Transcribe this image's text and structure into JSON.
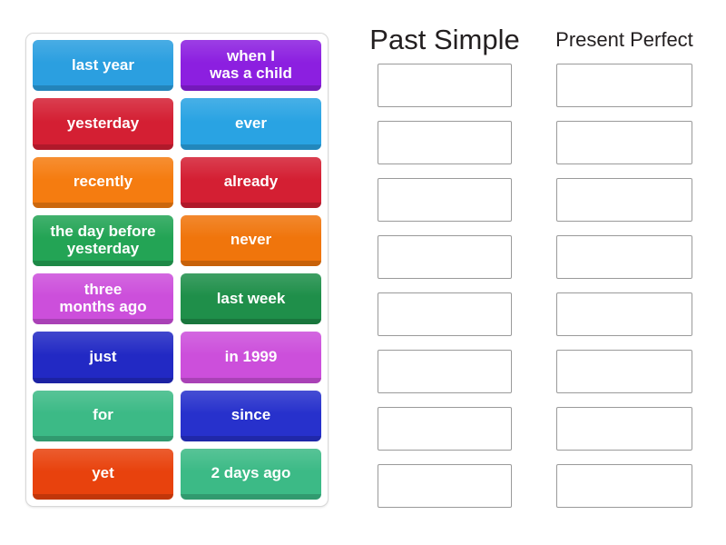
{
  "activity": {
    "type": "group-sort",
    "tile_pool": {
      "name": "word-tile-pool",
      "tiles": [
        {
          "label": "last year",
          "color": "#2b9fe0",
          "text_color": "#ffffff"
        },
        {
          "label": "when I\nwas a child",
          "color": "#8c1fe0",
          "text_color": "#ffffff"
        },
        {
          "label": "yesterday",
          "color": "#d41f33",
          "text_color": "#ffffff"
        },
        {
          "label": "ever",
          "color": "#29a3e3",
          "text_color": "#ffffff"
        },
        {
          "label": "recently",
          "color": "#f57c10",
          "text_color": "#ffffff"
        },
        {
          "label": "already",
          "color": "#d41f33",
          "text_color": "#ffffff"
        },
        {
          "label": "the day before\nyesterday",
          "color": "#23a455",
          "text_color": "#ffffff"
        },
        {
          "label": "never",
          "color": "#f0750c",
          "text_color": "#ffffff"
        },
        {
          "label": "three\nmonths ago",
          "color": "#cc4fdb",
          "text_color": "#ffffff"
        },
        {
          "label": "last week",
          "color": "#1f8f4a",
          "text_color": "#ffffff"
        },
        {
          "label": "just",
          "color": "#2229c4",
          "text_color": "#ffffff"
        },
        {
          "label": "in 1999",
          "color": "#cc4fdb",
          "text_color": "#ffffff"
        },
        {
          "label": "for",
          "color": "#3cba86",
          "text_color": "#ffffff"
        },
        {
          "label": "since",
          "color": "#2731cc",
          "text_color": "#ffffff"
        },
        {
          "label": "yet",
          "color": "#e8420d",
          "text_color": "#ffffff"
        },
        {
          "label": "2 days ago",
          "color": "#3cba86",
          "text_color": "#ffffff"
        }
      ]
    },
    "columns": [
      {
        "title": "Past Simple",
        "dropzone_count": 8,
        "dropzones": [
          "",
          "",
          "",
          "",
          "",
          "",
          "",
          ""
        ]
      },
      {
        "title": "Present Perfect",
        "dropzone_count": 8,
        "dropzones": [
          "",
          "",
          "",
          "",
          "",
          "",
          "",
          ""
        ]
      }
    ],
    "colors": {
      "background": "#ffffff",
      "pool_border": "#d8d8d8",
      "dropzone_border": "#9a9a9a",
      "title_text": "#231f20"
    }
  }
}
